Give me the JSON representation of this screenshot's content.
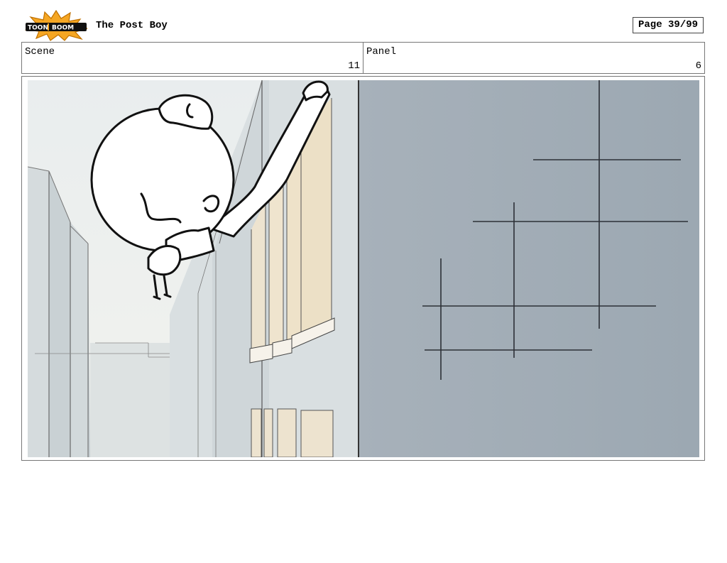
{
  "header": {
    "logo_text": "TOON BOOM",
    "title": "The Post Boy",
    "page_label": "Page 39/99"
  },
  "info": {
    "scene_label": "Scene",
    "scene_value": "11",
    "panel_label": "Panel",
    "panel_value": "6"
  },
  "panel": {
    "illustration": "storyboard-panel-sketch"
  }
}
